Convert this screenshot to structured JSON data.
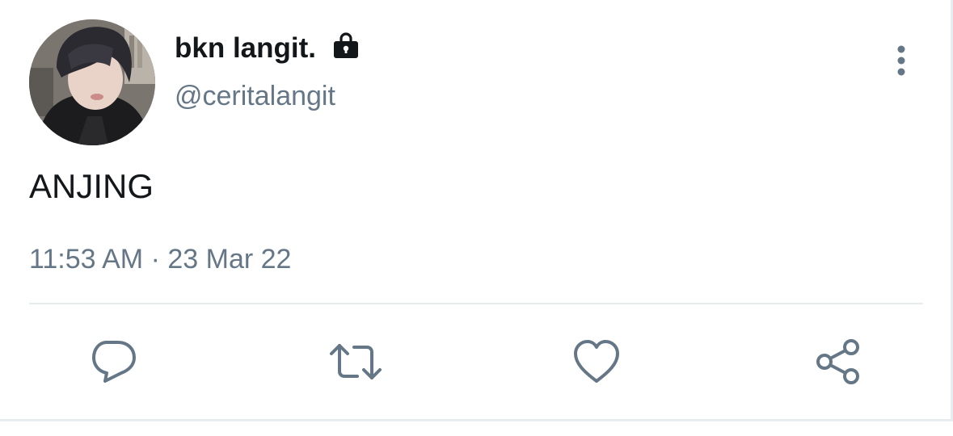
{
  "tweet": {
    "display_name": "bkn langit.",
    "handle": "@ceritalangit",
    "text": "ANJING",
    "time": "11:53 AM",
    "separator": "·",
    "date": "23 Mar 22",
    "protected_icon": "lock-icon",
    "menu_icon": "more-vertical-icon"
  },
  "actions": [
    {
      "name": "reply",
      "icon": "reply-icon"
    },
    {
      "name": "retweet",
      "icon": "retweet-icon"
    },
    {
      "name": "like",
      "icon": "heart-icon"
    },
    {
      "name": "share",
      "icon": "share-icon"
    }
  ],
  "colors": {
    "primary_text": "#14171a",
    "secondary_text": "#657786",
    "icon": "#657786",
    "divider": "#e6ecf0",
    "background": "#ffffff"
  }
}
